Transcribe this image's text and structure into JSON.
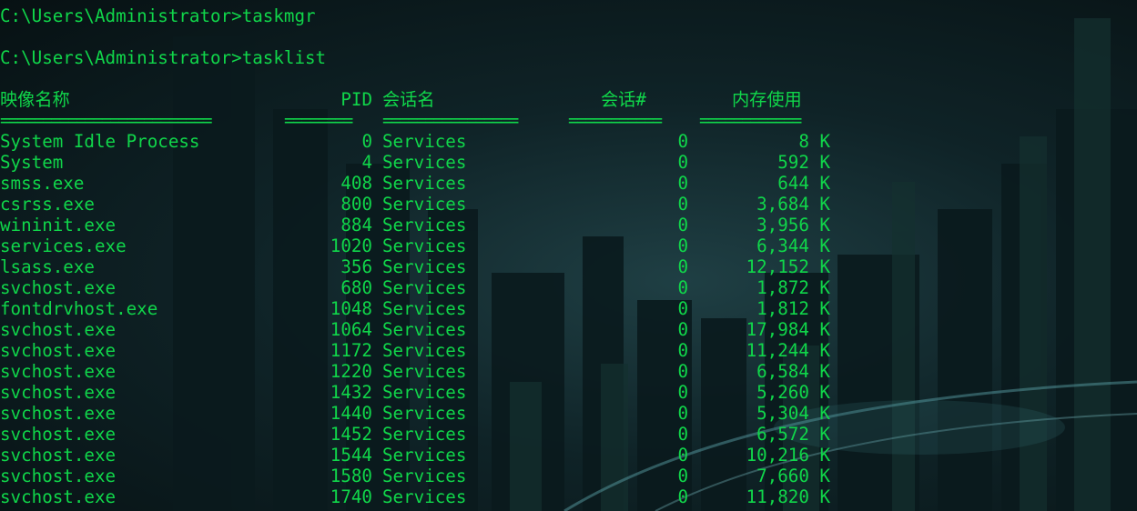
{
  "theme": {
    "text_color": "#10d64a",
    "background": "dark teal futuristic city wallpaper"
  },
  "console": {
    "prompts": [
      "C:\\Users\\Administrator>taskmgr",
      "C:\\Users\\Administrator>tasklist"
    ],
    "headers": [
      "映像名称",
      "PID",
      "会话名",
      "会话#",
      "内存使用"
    ],
    "separators": [
      "=========================",
      "========",
      "================",
      "===========",
      "============"
    ],
    "rows": [
      [
        "System Idle Process",
        "0",
        "Services",
        "0",
        "8 K"
      ],
      [
        "System",
        "4",
        "Services",
        "0",
        "592 K"
      ],
      [
        "smss.exe",
        "408",
        "Services",
        "0",
        "644 K"
      ],
      [
        "csrss.exe",
        "800",
        "Services",
        "0",
        "3,684 K"
      ],
      [
        "wininit.exe",
        "884",
        "Services",
        "0",
        "3,956 K"
      ],
      [
        "services.exe",
        "1020",
        "Services",
        "0",
        "6,344 K"
      ],
      [
        "lsass.exe",
        "356",
        "Services",
        "0",
        "12,152 K"
      ],
      [
        "svchost.exe",
        "680",
        "Services",
        "0",
        "1,872 K"
      ],
      [
        "fontdrvhost.exe",
        "1048",
        "Services",
        "0",
        "1,812 K"
      ],
      [
        "svchost.exe",
        "1064",
        "Services",
        "0",
        "17,984 K"
      ],
      [
        "svchost.exe",
        "1172",
        "Services",
        "0",
        "11,244 K"
      ],
      [
        "svchost.exe",
        "1220",
        "Services",
        "0",
        "6,584 K"
      ],
      [
        "svchost.exe",
        "1432",
        "Services",
        "0",
        "5,260 K"
      ],
      [
        "svchost.exe",
        "1440",
        "Services",
        "0",
        "5,304 K"
      ],
      [
        "svchost.exe",
        "1452",
        "Services",
        "0",
        "6,572 K"
      ],
      [
        "svchost.exe",
        "1544",
        "Services",
        "0",
        "10,216 K"
      ],
      [
        "svchost.exe",
        "1580",
        "Services",
        "0",
        "7,660 K"
      ],
      [
        "svchost.exe",
        "1740",
        "Services",
        "0",
        "11,820 K"
      ]
    ]
  }
}
